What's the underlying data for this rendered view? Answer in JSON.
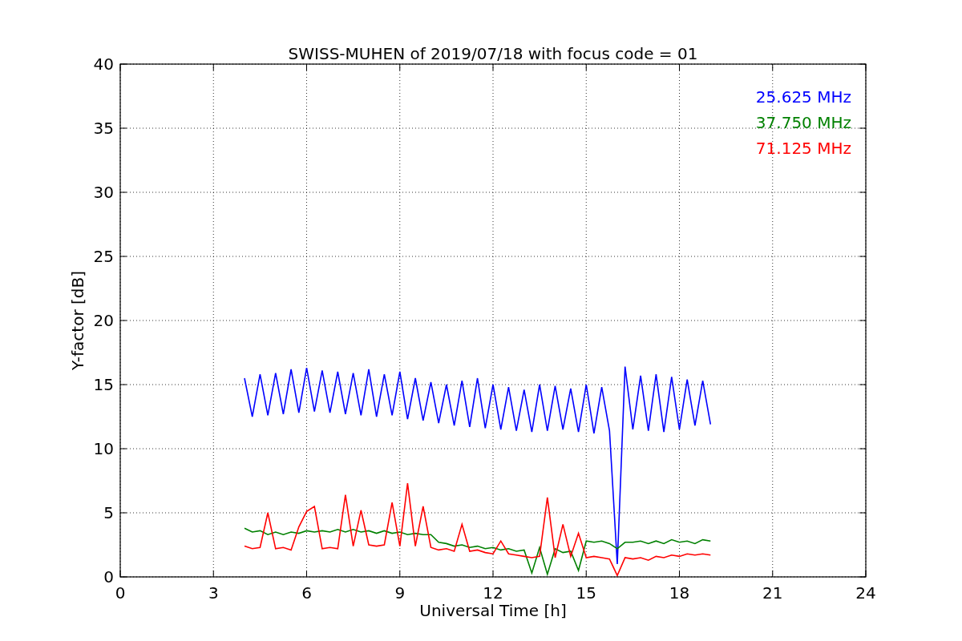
{
  "figure": {
    "chart_data": {
      "type": "line",
      "grid": true,
      "title": "SWISS-MUHEN of 2019/07/18 with focus code = 01",
      "xlabel": "Universal Time [h]",
      "ylabel": "Y-factor [dB]",
      "xlim": [
        0,
        24
      ],
      "ylim": [
        0,
        40
      ],
      "xticks": [
        0,
        3,
        6,
        9,
        12,
        15,
        18,
        21,
        24
      ],
      "yticks": [
        0,
        5,
        10,
        15,
        20,
        25,
        30,
        35,
        40
      ],
      "x": [
        4,
        4.25,
        4.5,
        4.75,
        5,
        5.25,
        5.5,
        5.75,
        6,
        6.25,
        6.5,
        6.75,
        7,
        7.25,
        7.5,
        7.75,
        8,
        8.25,
        8.5,
        8.75,
        9,
        9.25,
        9.5,
        9.75,
        10,
        10.25,
        10.5,
        10.75,
        11,
        11.25,
        11.5,
        11.75,
        12,
        12.25,
        12.5,
        12.75,
        13,
        13.25,
        13.5,
        13.75,
        14,
        14.25,
        14.5,
        14.75,
        15,
        15.25,
        15.5,
        15.75,
        16,
        16.25,
        16.5,
        16.75,
        17,
        17.25,
        17.5,
        17.75,
        18,
        18.25,
        18.5,
        18.75,
        19
      ],
      "series": [
        {
          "name": "25.625 MHz",
          "color": "#0000ff",
          "values": [
            15.5,
            12.5,
            15.8,
            12.6,
            15.9,
            12.7,
            16.2,
            12.8,
            16.3,
            12.9,
            16.1,
            12.8,
            16,
            12.7,
            15.9,
            12.6,
            16.2,
            12.5,
            15.8,
            12.6,
            16,
            12.3,
            15.5,
            12.2,
            15.2,
            12.0,
            15.0,
            11.8,
            15.3,
            11.7,
            15.5,
            11.6,
            15.0,
            11.5,
            14.8,
            11.4,
            14.6,
            11.3,
            15.0,
            11.4,
            14.9,
            11.5,
            14.7,
            11.3,
            15.0,
            11.2,
            14.8,
            11.4,
            1.0,
            16.4,
            11.5,
            15.7,
            11.4,
            15.8,
            11.3,
            15.6,
            11.5,
            15.4,
            11.8,
            15.3,
            11.9
          ]
        },
        {
          "name": "37.750 MHz",
          "color": "#008000",
          "values": [
            3.8,
            3.5,
            3.6,
            3.3,
            3.5,
            3.3,
            3.5,
            3.4,
            3.6,
            3.5,
            3.6,
            3.5,
            3.7,
            3.5,
            3.7,
            3.5,
            3.6,
            3.4,
            3.6,
            3.4,
            3.5,
            3.3,
            3.4,
            3.3,
            3.3,
            2.7,
            2.6,
            2.4,
            2.5,
            2.3,
            2.4,
            2.2,
            2.3,
            2.1,
            2.2,
            2.0,
            2.1,
            0.3,
            2.3,
            0.2,
            2.2,
            1.9,
            2.0,
            0.5,
            2.8,
            2.7,
            2.8,
            2.6,
            2.2,
            2.7,
            2.7,
            2.8,
            2.6,
            2.8,
            2.6,
            2.9,
            2.7,
            2.8,
            2.6,
            2.9,
            2.8
          ]
        },
        {
          "name": "71.125 MHz",
          "color": "#ff0000",
          "values": [
            2.4,
            2.2,
            2.3,
            5.0,
            2.2,
            2.3,
            2.1,
            3.9,
            5.1,
            5.5,
            2.2,
            2.3,
            2.2,
            6.4,
            2.4,
            5.2,
            2.5,
            2.4,
            2.5,
            5.8,
            2.4,
            7.3,
            2.4,
            5.5,
            2.3,
            2.1,
            2.2,
            2.0,
            4.1,
            2.0,
            2.1,
            1.9,
            1.8,
            2.8,
            1.8,
            1.7,
            1.6,
            1.5,
            1.6,
            6.2,
            1.5,
            4.1,
            1.6,
            3.4,
            1.5,
            1.6,
            1.5,
            1.4,
            0.1,
            1.5,
            1.4,
            1.5,
            1.3,
            1.6,
            1.5,
            1.7,
            1.6,
            1.8,
            1.7,
            1.8,
            1.7
          ]
        }
      ]
    }
  }
}
